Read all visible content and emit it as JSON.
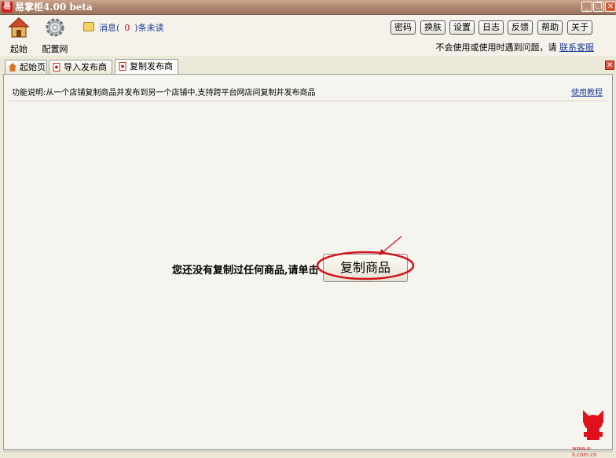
{
  "window": {
    "app_icon": "易",
    "title": "易掌柜4.00 beta",
    "minimize": "_",
    "restore": "❐",
    "close": "✕"
  },
  "toolbar": {
    "home_label": "起始页",
    "config_label": "配置网店",
    "message_prefix": "消息(",
    "message_count": "0",
    "message_suffix": ")条未读",
    "buttons": [
      "密码",
      "换肤",
      "设置",
      "日志",
      "反馈",
      "帮助",
      "关于"
    ],
    "help_text": "不会使用或使用时遇到问题，请",
    "help_link": "联系客服"
  },
  "tabs": [
    {
      "label": "起始页",
      "icon": "home-icon"
    },
    {
      "label": "导入发布商品",
      "icon": "page-icon"
    },
    {
      "label": "复制发布商品",
      "icon": "page-icon",
      "active": true
    }
  ],
  "panel": {
    "description": "功能说明:从一个店铺复制商品并发布到另一个店铺中,支持跨平台网店间复制并发布商品",
    "tutorial_link": "使用教程",
    "empty_prompt": "您还没有复制过任何商品,请单击",
    "copy_button": "复制商品"
  },
  "watermark": "www.a-li.com.cn",
  "colors": {
    "accent_red": "#d21f1f",
    "link_blue": "#1e3e9a",
    "titlebar": "#a9826b"
  }
}
